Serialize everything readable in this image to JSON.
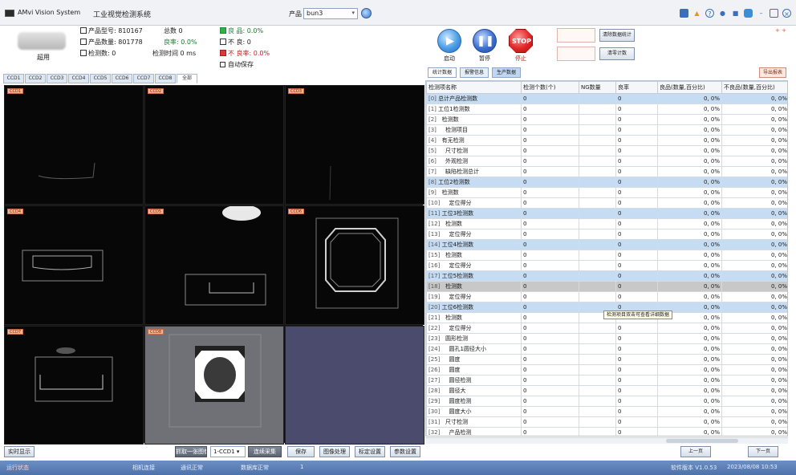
{
  "titlebar": {
    "app_name": "AMvi Vision System",
    "window_title": "工业视觉检测系统",
    "product_label": "产品",
    "product_value": "bun3",
    "icons": [
      "minimize-icon",
      "help-icon",
      "user-icon",
      "lock-icon",
      "settings-icon",
      "maximize-icon",
      "close-icon"
    ]
  },
  "info": {
    "user_name": "超用",
    "stats": [
      "产品型号: 810167",
      "产品数量: 801778",
      "检测数: 0",
      "总数 0",
      "良率: 0.0%",
      "检测时间 0 ms",
      "良 品: 0.0%",
      "不 良: 0",
      "不 良率: 0.0%"
    ],
    "auto_save_label": "自动保存"
  },
  "camera_tabs": [
    "CCD1",
    "CCD2",
    "CCD3",
    "CCD4",
    "CCD5",
    "CCD6",
    "CCD7",
    "CCD8",
    "全部"
  ],
  "camera_labels": [
    "CCD1",
    "CCD2",
    "CCD3",
    "CCD4",
    "CCD5",
    "CCD6",
    "CCD7",
    "CCD8"
  ],
  "bottom_left": {
    "realtime_btn": "实时显示",
    "capture_btn": "抓取一张图像",
    "cam_select": "1-CCD1",
    "cam_select_chevron": "▾",
    "live_btn": "连续采集",
    "buttons": [
      "保存",
      "图像处理",
      "标定设置",
      "参数设置"
    ]
  },
  "statusbar": {
    "status": "运行状态",
    "items": [
      "相机连接",
      "通讯正常",
      "数据库正常",
      "1"
    ],
    "right_info": "软件版本 V1.0.53",
    "datetime": "2023/08/08 10:53"
  },
  "controls": {
    "start_label": "启动",
    "pause_label": "暂停",
    "stop_label": "停止",
    "stop_text": "STOP",
    "reset_btn": "清除数据统计",
    "clear_btn": "清零计数",
    "corner": "+ +"
  },
  "right_tabs": [
    "统计数据",
    "报警信息",
    "生产数据"
  ],
  "report_btn": "导出报表",
  "table": {
    "headers": [
      "检测项名称",
      "检测个数(个)",
      "NG数量",
      "良率",
      "良品(数量,百分比)",
      "不良品(数量,百分比)"
    ],
    "rows": [
      {
        "idx": "[0]",
        "name": "总计产品检测数",
        "count": "0",
        "ng": "",
        "rate": "0",
        "ok": "0,  0%",
        "bad": "0,  0%",
        "style": "blue"
      },
      {
        "idx": "[1]",
        "name": "工位1检测数",
        "count": "0",
        "ng": "",
        "rate": "0",
        "ok": "0,  0%",
        "bad": "0,  0%",
        "style": "plain"
      },
      {
        "idx": "[2]",
        "name": "  检测数",
        "count": "0",
        "ng": "",
        "rate": "0",
        "ok": "0,  0%",
        "bad": "0,  0%",
        "style": "plain"
      },
      {
        "idx": "[3]",
        "name": "    检测项目",
        "count": "0",
        "ng": "",
        "rate": "0",
        "ok": "0,  0%",
        "bad": "0,  0%",
        "style": "plain"
      },
      {
        "idx": "[4]",
        "name": "  有无检测",
        "count": "0",
        "ng": "",
        "rate": "0",
        "ok": "0,  0%",
        "bad": "0,  0%",
        "style": "plain"
      },
      {
        "idx": "[5]",
        "name": "    尺寸检测",
        "count": "0",
        "ng": "",
        "rate": "0",
        "ok": "0,  0%",
        "bad": "0,  0%",
        "style": "plain"
      },
      {
        "idx": "[6]",
        "name": "    外观检测",
        "count": "0",
        "ng": "",
        "rate": "0",
        "ok": "0,  0%",
        "bad": "0,  0%",
        "style": "plain"
      },
      {
        "idx": "[7]",
        "name": "    缺陷检测总计",
        "count": "0",
        "ng": "",
        "rate": "0",
        "ok": "0,  0%",
        "bad": "0,  0%",
        "style": "plain"
      },
      {
        "idx": "[8]",
        "name": "工位2检测数",
        "count": "0",
        "ng": "",
        "rate": "0",
        "ok": "0,  0%",
        "bad": "0,  0%",
        "style": "blue"
      },
      {
        "idx": "[9]",
        "name": "  检测数",
        "count": "0",
        "ng": "",
        "rate": "0",
        "ok": "0,  0%",
        "bad": "0,  0%",
        "style": "plain"
      },
      {
        "idx": "[10]",
        "name": "    定位得分",
        "count": "0",
        "ng": "",
        "rate": "0",
        "ok": "0,  0%",
        "bad": "0,  0%",
        "style": "plain"
      },
      {
        "idx": "[11]",
        "name": "工位3检测数",
        "count": "0",
        "ng": "",
        "rate": "0",
        "ok": "0,  0%",
        "bad": "0,  0%",
        "style": "blue"
      },
      {
        "idx": "[12]",
        "name": "  检测数",
        "count": "0",
        "ng": "",
        "rate": "0",
        "ok": "0,  0%",
        "bad": "0,  0%",
        "style": "plain"
      },
      {
        "idx": "[13]",
        "name": "    定位得分",
        "count": "0",
        "ng": "",
        "rate": "0",
        "ok": "0,  0%",
        "bad": "0,  0%",
        "style": "plain"
      },
      {
        "idx": "[14]",
        "name": "工位4检测数",
        "count": "0",
        "ng": "",
        "rate": "0",
        "ok": "0,  0%",
        "bad": "0,  0%",
        "style": "blue"
      },
      {
        "idx": "[15]",
        "name": "  检测数",
        "count": "0",
        "ng": "",
        "rate": "0",
        "ok": "0,  0%",
        "bad": "0,  0%",
        "style": "plain"
      },
      {
        "idx": "[16]",
        "name": "    定位得分",
        "count": "0",
        "ng": "",
        "rate": "0",
        "ok": "0,  0%",
        "bad": "0,  0%",
        "style": "plain"
      },
      {
        "idx": "[17]",
        "name": "工位5检测数",
        "count": "0",
        "ng": "",
        "rate": "0",
        "ok": "0,  0%",
        "bad": "0,  0%",
        "style": "blue"
      },
      {
        "idx": "[18]",
        "name": "  检测数",
        "count": "0",
        "ng": "",
        "rate": "0",
        "ok": "0,  0%",
        "bad": "0,  0%",
        "style": "sel"
      },
      {
        "idx": "[19]",
        "name": "    定位得分",
        "count": "0",
        "ng": "",
        "rate": "0",
        "ok": "0,  0%",
        "bad": "0,  0%",
        "style": "plain"
      },
      {
        "idx": "[20]",
        "name": "工位6检测数",
        "count": "0",
        "ng": "",
        "rate": "0",
        "ok": "0,  0%",
        "bad": "0,  0%",
        "style": "blue"
      },
      {
        "idx": "[21]",
        "name": "  检测数",
        "count": "0",
        "ng": "",
        "rate": "0",
        "ok": "0,  0%",
        "bad": "0,  0%",
        "style": "plain"
      },
      {
        "idx": "[22]",
        "name": "    定位得分",
        "count": "0",
        "ng": "",
        "rate": "0",
        "ok": "0,  0%",
        "bad": "0,  0%",
        "style": "plain"
      },
      {
        "idx": "[23]",
        "name": "  圆形检测",
        "count": "0",
        "ng": "",
        "rate": "0",
        "ok": "0,  0%",
        "bad": "0,  0%",
        "style": "plain"
      },
      {
        "idx": "[24]",
        "name": "    圆孔1圆径大小",
        "count": "0",
        "ng": "",
        "rate": "0",
        "ok": "0,  0%",
        "bad": "0,  0%",
        "style": "plain"
      },
      {
        "idx": "[25]",
        "name": "    圆度",
        "count": "0",
        "ng": "",
        "rate": "0",
        "ok": "0,  0%",
        "bad": "0,  0%",
        "style": "plain"
      },
      {
        "idx": "[26]",
        "name": "    圆度",
        "count": "0",
        "ng": "",
        "rate": "0",
        "ok": "0,  0%",
        "bad": "0,  0%",
        "style": "plain"
      },
      {
        "idx": "[27]",
        "name": "    圆径检测",
        "count": "0",
        "ng": "",
        "rate": "0",
        "ok": "0,  0%",
        "bad": "0,  0%",
        "style": "plain"
      },
      {
        "idx": "[28]",
        "name": "    圆径大",
        "count": "0",
        "ng": "",
        "rate": "0",
        "ok": "0,  0%",
        "bad": "0,  0%",
        "style": "plain"
      },
      {
        "idx": "[29]",
        "name": "    圆度检测",
        "count": "0",
        "ng": "",
        "rate": "0",
        "ok": "0,  0%",
        "bad": "0,  0%",
        "style": "plain"
      },
      {
        "idx": "[30]",
        "name": "    圆度大小",
        "count": "0",
        "ng": "",
        "rate": "0",
        "ok": "0,  0%",
        "bad": "0,  0%",
        "style": "plain"
      },
      {
        "idx": "[31]",
        "name": "  尺寸检测",
        "count": "0",
        "ng": "",
        "rate": "0",
        "ok": "0,  0%",
        "bad": "0,  0%",
        "style": "plain"
      },
      {
        "idx": "[32]",
        "name": "    产品检测",
        "count": "0",
        "ng": "",
        "rate": "0",
        "ok": "0,  0%",
        "bad": "0,  0%",
        "style": "plain"
      }
    ]
  },
  "tooltip": "检测项目双击可查看详细数据",
  "right_bottom_buttons": [
    "上一页",
    "下一页"
  ],
  "colors": {
    "accent_blue": "#c6dcf3",
    "status_bar": "#4d72aa",
    "stop_red": "#e02828",
    "cam_label_bg": "#f3b293"
  }
}
